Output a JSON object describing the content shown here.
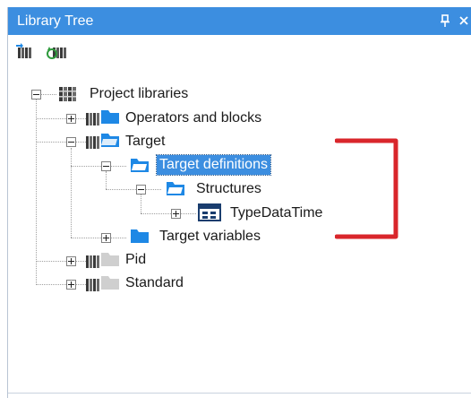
{
  "panel": {
    "title": "Library Tree",
    "pin_glyph": "pin-icon",
    "close_glyph": "close-icon"
  },
  "toolbar": {
    "buttons": [
      {
        "icon": "collapse-all-icon"
      },
      {
        "icon": "refresh-libraries-icon"
      }
    ]
  },
  "tree": {
    "nodes": [
      {
        "label": "Project libraries",
        "expanded": true,
        "icon": "library-books-icon"
      },
      {
        "label": "Operators and blocks",
        "expanded": false,
        "icon": "library-folder-icon"
      },
      {
        "label": "Target",
        "expanded": true,
        "icon": "library-folder-icon"
      },
      {
        "label": "Target definitions",
        "expanded": true,
        "selected": true,
        "icon": "folder-icon"
      },
      {
        "label": "Structures",
        "expanded": true,
        "icon": "folder-icon"
      },
      {
        "label": "TypeDataTime",
        "expanded": false,
        "icon": "structure-type-icon"
      },
      {
        "label": "Target variables",
        "expanded": false,
        "icon": "folder-icon"
      },
      {
        "label": "Pid",
        "expanded": false,
        "icon": "library-gray-icon"
      },
      {
        "label": "Standard",
        "expanded": false,
        "icon": "library-gray-icon"
      }
    ]
  },
  "colors": {
    "accent": "#3c8ee0",
    "folder": "#1e88e5",
    "annotation": "#d9262b"
  }
}
